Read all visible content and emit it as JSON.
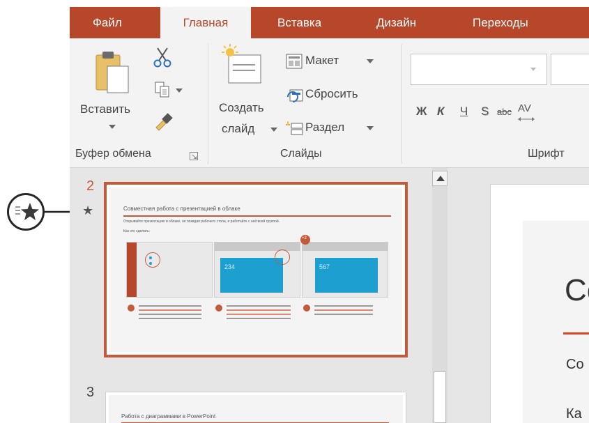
{
  "tabs": [
    "Файл",
    "Главная",
    "Вставка",
    "Дизайн",
    "Переходы"
  ],
  "active_tab": "Главная",
  "clipboard": {
    "paste_label": "Вставить",
    "group_label": "Буфер обмена"
  },
  "slides_group": {
    "new_slide_line1": "Создать",
    "new_slide_line2": "слайд",
    "layout": "Макет",
    "reset": "Сбросить",
    "section": "Раздел",
    "group_label": "Слайды"
  },
  "font_group": {
    "group_label": "Шрифт",
    "bold": "Ж",
    "italic": "К",
    "underline": "Ч",
    "shadow": "S",
    "strike": "abc",
    "spacing": "AV"
  },
  "slide_panel": {
    "slides": [
      {
        "number": "2",
        "title": "Совместная работа с презентацией в облаке",
        "subtitle": "Открывайте презентацию в облаке, не покидая рабочего стола, и работайте с ней всей группой.",
        "caption": "Как это сделать:",
        "screenshot_numbers": [
          "234",
          "567"
        ],
        "badge": "+2",
        "has_transition": true,
        "selected": true
      },
      {
        "number": "3",
        "title": "Работа с диаграммами в PowerPoint",
        "selected": false
      }
    ],
    "transition_icon": "star-icon"
  },
  "editor": {
    "title_fragment": "Со",
    "line1_fragment": "Со",
    "line2_fragment": "Ка"
  },
  "colors": {
    "accent": "#b7472a",
    "selection_border": "#c55a3a",
    "ribbon_bg": "#f3f3f3",
    "panel_bg": "#e6e6e6",
    "screenshot_blue": "#1d9fd0"
  }
}
